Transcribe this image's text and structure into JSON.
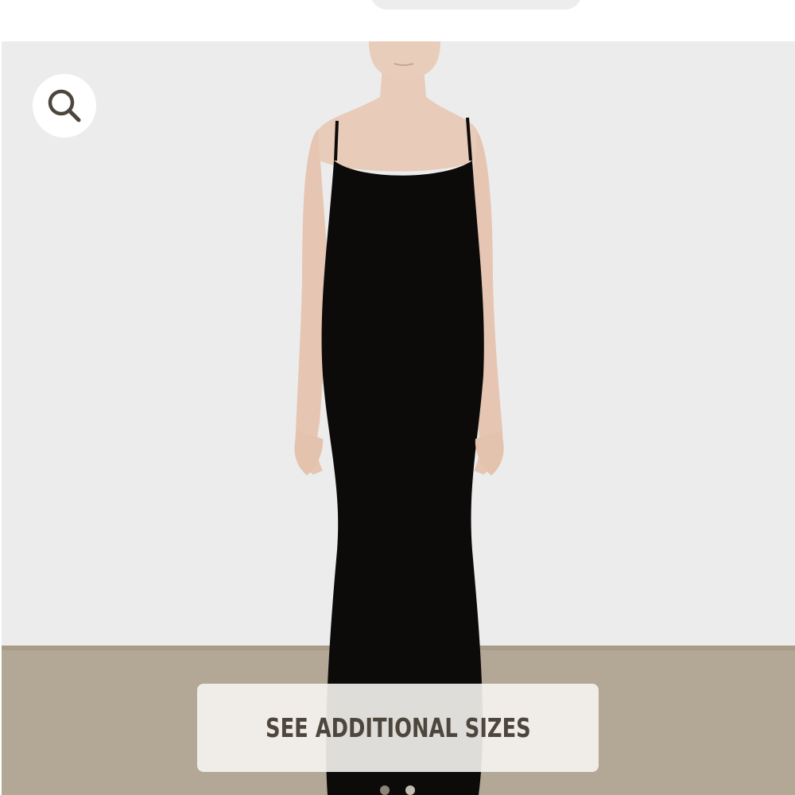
{
  "header": {
    "search_pill": ""
  },
  "product_gallery": {
    "image_alt": "Model wearing black sleeveless maxi dress",
    "dress_color": "#0d0b0a",
    "backdrop_wall_color": "#ececec",
    "backdrop_floor_color": "#b3a795"
  },
  "search_button": {
    "icon": "search-icon"
  },
  "sizes_button": {
    "label": "SEE ADDITIONAL SIZES"
  },
  "carousel": {
    "dots": 2
  },
  "colors": {
    "button_text": "#4d463d",
    "search_icon": "#4d463d"
  }
}
